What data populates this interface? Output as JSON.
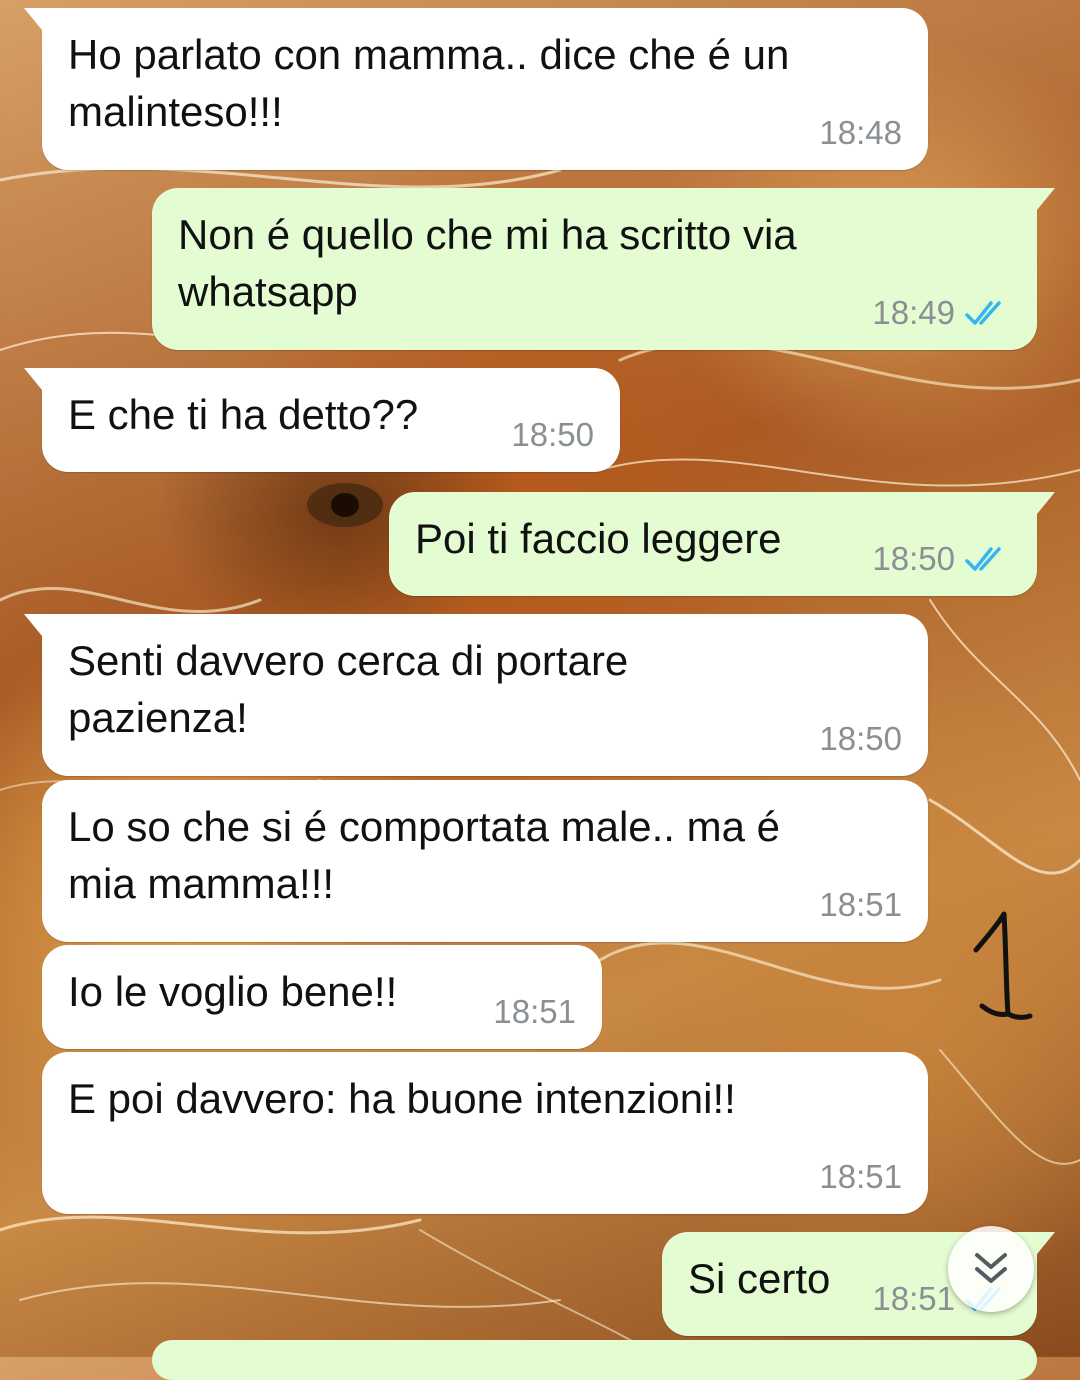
{
  "colors": {
    "incoming_bubble": "#ffffff",
    "outgoing_bubble": "#e4fcd1",
    "timestamp": "#8a8f93",
    "read_ticks": "#34b7f1",
    "wallpaper_theme": "lion mane, orange and gold"
  },
  "messages": [
    {
      "direction": "incoming",
      "text": "Ho parlato con mamma.. dice che é un\nmalinteso!!!",
      "time": "18:48"
    },
    {
      "direction": "outgoing",
      "text": "Non é quello che mi ha scritto via\nwhatsapp",
      "time": "18:49",
      "status": "read"
    },
    {
      "direction": "incoming",
      "text": "E che ti ha detto??",
      "time": "18:50"
    },
    {
      "direction": "outgoing",
      "text": "Poi ti faccio leggere",
      "time": "18:50",
      "status": "read"
    },
    {
      "direction": "incoming",
      "text": "Senti davvero cerca di portare\npazienza!",
      "time": "18:50"
    },
    {
      "direction": "incoming",
      "text": "Lo so che si é comportata male.. ma é\nmia mamma!!!",
      "time": "18:51"
    },
    {
      "direction": "incoming",
      "text": "Io le voglio bene!!",
      "time": "18:51"
    },
    {
      "direction": "incoming",
      "text": "E poi davvero: ha buone intenzioni!!",
      "time": "18:51"
    },
    {
      "direction": "outgoing",
      "text": "Si certo",
      "time": "18:51",
      "status": "read"
    }
  ],
  "annotation": {
    "handwritten_mark": "1"
  },
  "icons": {
    "scroll_to_bottom": "double-chevron-down-icon",
    "read_receipt": "double-check-icon"
  }
}
